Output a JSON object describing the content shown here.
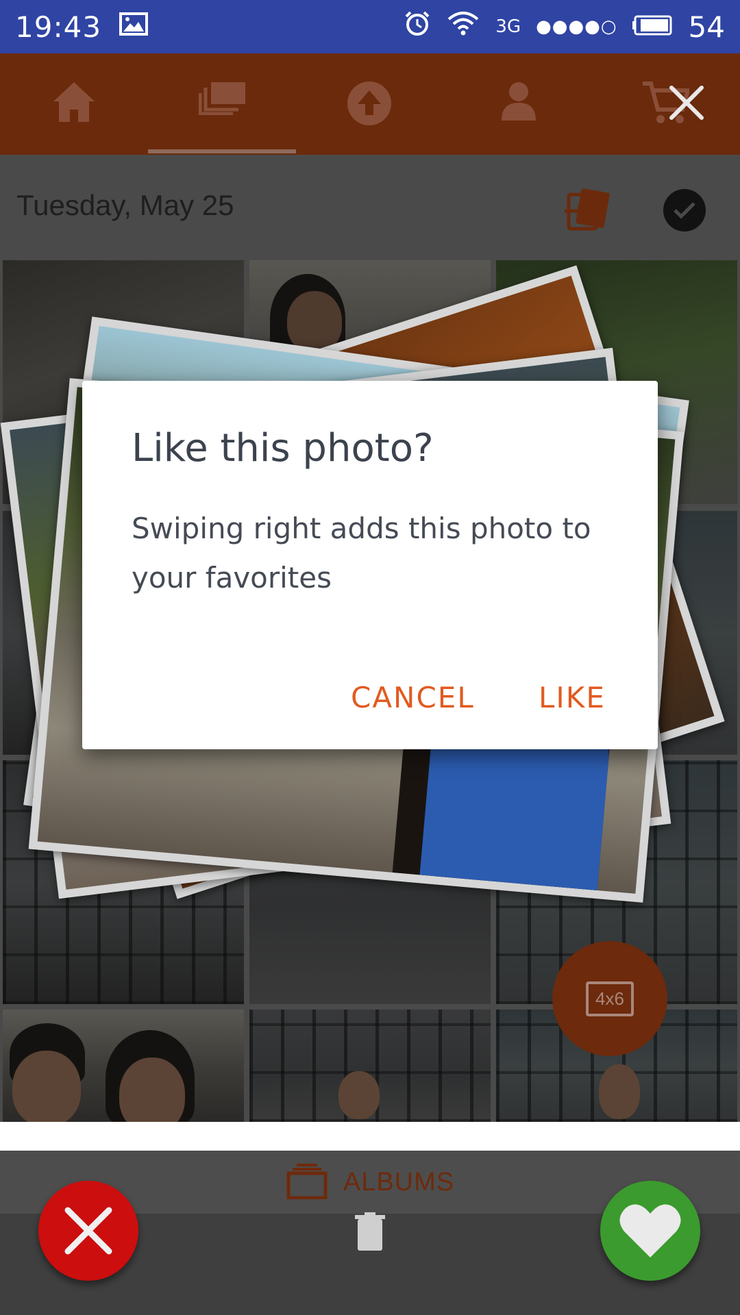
{
  "status_bar": {
    "time": "19:43",
    "network": "3G",
    "signal_dots": "●●●●○",
    "battery": "54"
  },
  "header": {
    "nav_items": [
      "home-icon",
      "photos-icon",
      "upload-icon",
      "profile-icon",
      "cart-icon"
    ],
    "active_tab_index": 1
  },
  "date_bar": {
    "date": "Tuesday, May 25"
  },
  "fab": {
    "label": "4x6"
  },
  "albums": {
    "label": "ALBUMS"
  },
  "dialog": {
    "title": "Like this photo?",
    "body": "Swiping right adds this photo to your favorites",
    "cancel_label": "CANCEL",
    "like_label": "LIKE"
  },
  "colors": {
    "status_bar": "#2f44a3",
    "header_dimmed": "#6b2a0c",
    "accent": "#e15a20",
    "reject": "#cc0e0e",
    "favorite": "#3b9b2e"
  }
}
